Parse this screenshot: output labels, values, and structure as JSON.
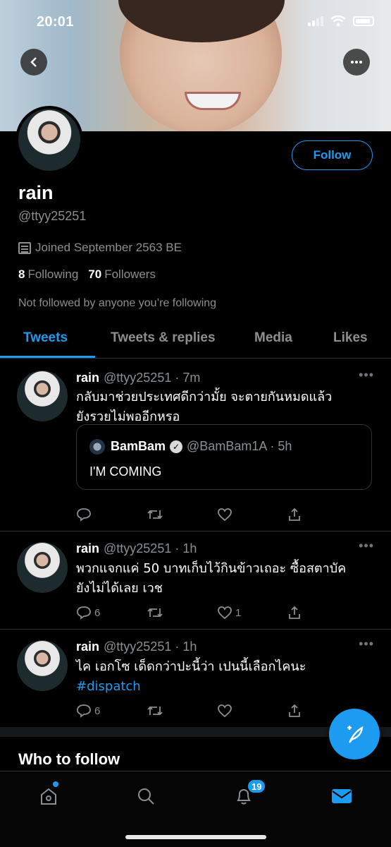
{
  "status": {
    "time": "20:01"
  },
  "profile": {
    "name": "rain",
    "handle": "@ttyy25251",
    "joined": "Joined September 2563 BE",
    "following_count": "8",
    "following_label": "Following",
    "followers_count": "70",
    "followers_label": "Followers",
    "not_followed": "Not followed by anyone you’re following",
    "follow_button": "Follow"
  },
  "tabs": [
    {
      "label": "Tweets",
      "active": true
    },
    {
      "label": "Tweets & replies"
    },
    {
      "label": "Media"
    },
    {
      "label": "Likes"
    }
  ],
  "tweets": [
    {
      "name": "rain",
      "meta": "@ttyy25251 · 7m",
      "text_line1": "กลับมาช่วยประเทศดีกว่ามั้ย จะตายกันหมดแล้ว",
      "text_line2": "ยังรวยไม่พออีกหรอ",
      "quote": {
        "name": "BamBam",
        "meta": "@BamBam1A · 5h",
        "text": "I'M COMING"
      },
      "replies": "",
      "retweets": "",
      "likes": ""
    },
    {
      "name": "rain",
      "meta": "@ttyy25251 · 1h",
      "text_line1": "พวกแจกแค่ 50 บาทเก็บไว้กินข้าวเถอะ ซื้อสตาบัค",
      "text_line2": "ยังไม่ได้เลย เวช",
      "replies": "6",
      "retweets": "",
      "likes": "1"
    },
    {
      "name": "rain",
      "meta": "@ttyy25251 · 1h",
      "text_line1": "ไค เอกโซ เด็ดกว่าปะนี้ว่า เปนนี้เลือกไคนะ",
      "hashtag": "#dispatch",
      "replies": "6",
      "retweets": "",
      "likes": ""
    }
  ],
  "who_to_follow": "Who to follow",
  "nav": {
    "notification_badge": "19"
  },
  "colors": {
    "accent": "#1d9bf0",
    "background": "#000000",
    "muted": "#8a8f93"
  }
}
